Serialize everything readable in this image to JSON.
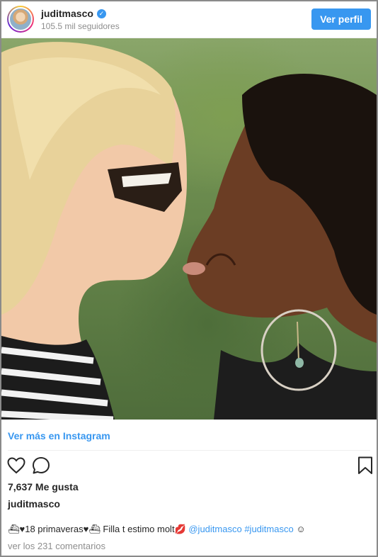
{
  "header": {
    "username": "juditmasco",
    "followers": "105.5 mil seguidores",
    "profile_button": "Ver perfil"
  },
  "post": {
    "more_link": "Ver más en Instagram",
    "likes": "7,637 Me gusta",
    "owner": "juditmasco",
    "caption_text": "⛴♥18 primaveras♥⛴ Filla t estimo molt💋 ",
    "caption_mention": "@juditmasco",
    "caption_hashtag": "#juditmasco",
    "caption_end": " ☺",
    "comments_link": "ver los 231 comentarios"
  },
  "icons": {
    "heart": "heart-icon",
    "comment": "comment-icon",
    "bookmark": "bookmark-icon",
    "verified": "verified-badge-icon"
  },
  "colors": {
    "accent": "#3897f0",
    "text": "#262626",
    "muted": "#8e8e8e"
  }
}
